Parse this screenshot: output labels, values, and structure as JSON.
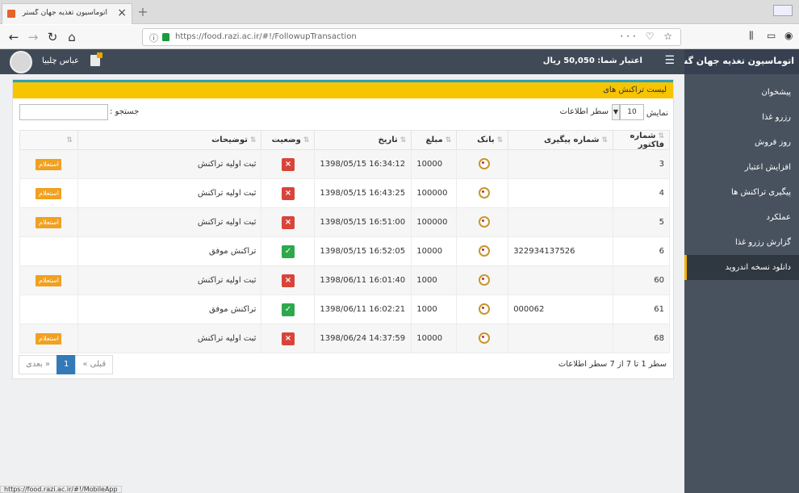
{
  "browser": {
    "tab_title": "اتوماسیون تغذیه جهان گستر",
    "tab_close": "×",
    "new_tab": "+",
    "url": "https://food.razi.ac.ir/#!/FollowupTransaction",
    "url_actions": "··· ♡ ☆",
    "status_url": "https://food.razi.ac.ir/#!/MobileApp"
  },
  "header": {
    "user_name": "عباس چلبیا",
    "credit": "اعتبار شما: 50,050 ریال",
    "menu_icon": "☰",
    "brand": "اتوماسیون تغذیه جهان گستر"
  },
  "sidebar": {
    "items": [
      {
        "label": "پیشخوان"
      },
      {
        "label": "رزرو غذا"
      },
      {
        "label": "روز فروش"
      },
      {
        "label": "افزایش اعتبار"
      },
      {
        "label": "پیگیری تراکنش ها"
      },
      {
        "label": "عملکرد"
      },
      {
        "label": "گزارش رزرو غذا"
      },
      {
        "label": "دانلود نسخه اندروید"
      }
    ]
  },
  "panel": {
    "title": "لیست تراکنش های",
    "show_label": "نمایش",
    "page_length": "10",
    "rows_suffix": "سطر اطلاعات",
    "search_label": "جستجو :"
  },
  "table": {
    "headers": {
      "invoice": "شماره فاکتور",
      "tracking": "شماره پیگیری",
      "bank": "بانک",
      "amount": "مبلغ",
      "date": "تاریخ",
      "status": "وضعیت",
      "description": "توضیحات",
      "action": ""
    },
    "rows": [
      {
        "invoice": "3",
        "tracking": "",
        "amount": "10000",
        "date": "1398/05/15 16:34:12",
        "status": "fail",
        "status_icon": "×",
        "description": "ثبت اولیه تراکنش",
        "action": "استعلام"
      },
      {
        "invoice": "4",
        "tracking": "",
        "amount": "100000",
        "date": "1398/05/15 16:43:25",
        "status": "fail",
        "status_icon": "×",
        "description": "ثبت اولیه تراکنش",
        "action": "استعلام"
      },
      {
        "invoice": "5",
        "tracking": "",
        "amount": "100000",
        "date": "1398/05/15 16:51:00",
        "status": "fail",
        "status_icon": "×",
        "description": "ثبت اولیه تراکنش",
        "action": "استعلام"
      },
      {
        "invoice": "6",
        "tracking": "322934137526",
        "amount": "10000",
        "date": "1398/05/15 16:52:05",
        "status": "ok",
        "status_icon": "✓",
        "description": "تراکنش موفق",
        "action": ""
      },
      {
        "invoice": "60",
        "tracking": "",
        "amount": "1000",
        "date": "1398/06/11 16:01:40",
        "status": "fail",
        "status_icon": "×",
        "description": "ثبت اولیه تراکنش",
        "action": "استعلام"
      },
      {
        "invoice": "61",
        "tracking": "000062",
        "amount": "1000",
        "date": "1398/06/11 16:02:21",
        "status": "ok",
        "status_icon": "✓",
        "description": "تراکنش موفق",
        "action": ""
      },
      {
        "invoice": "68",
        "tracking": "",
        "amount": "10000",
        "date": "1398/06/24 14:37:59",
        "status": "fail",
        "status_icon": "×",
        "description": "ثبت اولیه تراکنش",
        "action": "استعلام"
      }
    ]
  },
  "pagination": {
    "prev": "« قبلی",
    "current": "1",
    "next": "بعدی »",
    "info": "سطر 1 تا 7 از 7 سطر اطلاعات"
  },
  "colors": {
    "header_bg": "#404a57",
    "sidebar_bg": "#48525f",
    "panel_head": "#f7c400",
    "inquiry_button": "#f0a120",
    "status_fail": "#d9443a",
    "status_ok": "#2ea84d"
  }
}
